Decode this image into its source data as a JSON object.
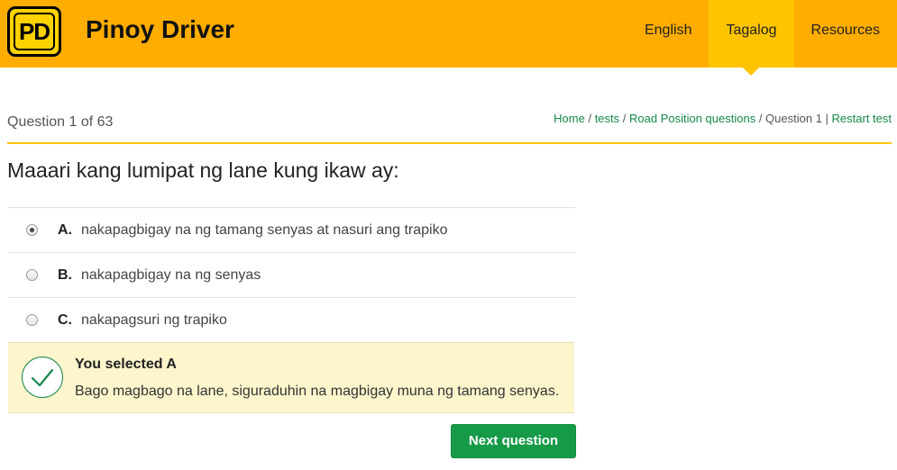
{
  "brand": {
    "logo_text": "PD",
    "name": "Pinoy Driver"
  },
  "nav": {
    "items": [
      {
        "label": "English",
        "active": false
      },
      {
        "label": "Tagalog",
        "active": true
      },
      {
        "label": "Resources",
        "active": false
      }
    ]
  },
  "quiz": {
    "counter": "Question 1 of 63",
    "question": "Maaari kang lumipat ng lane kung ikaw ay:",
    "selected": "A",
    "options": [
      {
        "letter": "A.",
        "text": "nakapagbigay na ng tamang senyas at nasuri ang trapiko"
      },
      {
        "letter": "B.",
        "text": "nakapagbigay na ng senyas"
      },
      {
        "letter": "C.",
        "text": "nakapagsuri ng trapiko"
      }
    ]
  },
  "breadcrumb": {
    "home": "Home",
    "sep1": " / ",
    "tests": "tests",
    "sep2": " / ",
    "category": "Road Position questions",
    "sep3": " / ",
    "current": "Question 1",
    "sep4": " | ",
    "restart": "Restart test"
  },
  "feedback": {
    "icon": "check-icon",
    "title": "You selected A",
    "text": "Bago magbago na lane, siguraduhin na magbigay muna ng tamang senyas."
  },
  "actions": {
    "next_label": "Next question"
  },
  "colors": {
    "header": "#ffad00",
    "nav_active": "#ffc400",
    "link": "#16884a",
    "button": "#169a48",
    "feedback_bg": "#fdf5cc"
  }
}
